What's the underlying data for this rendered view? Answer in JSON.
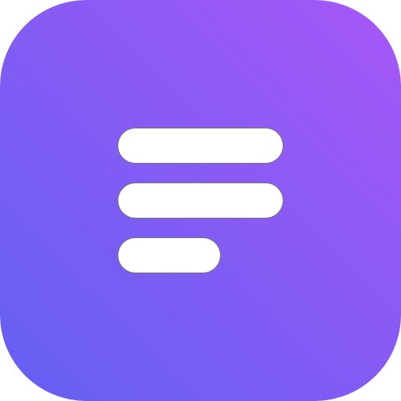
{
  "icon": {
    "name": "menu-lines-icon",
    "gradient": {
      "top_right": "#A657F6",
      "bottom_left": "#6360F2"
    },
    "bar_color": "#FFFFFF"
  }
}
